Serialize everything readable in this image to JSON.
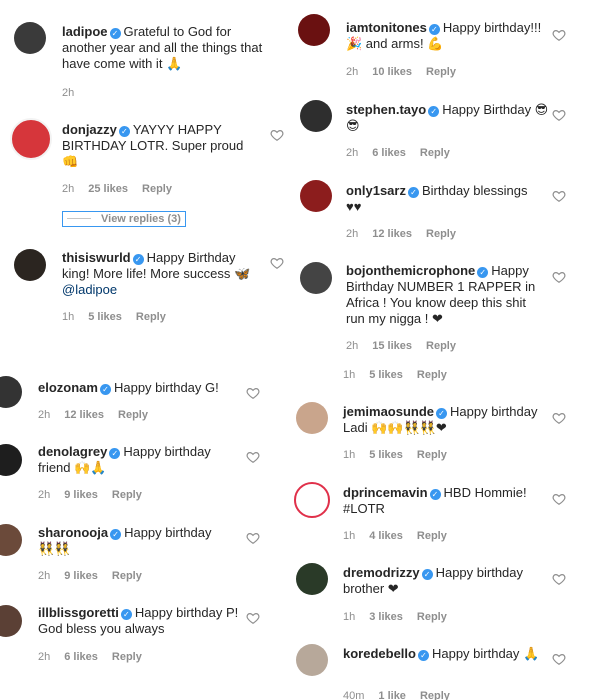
{
  "left_top": [
    {
      "user": "ladipoe",
      "text": "Grateful to God for another year and all the things that have come with it 🙏",
      "time": "2h",
      "likes": "",
      "reply": ""
    },
    {
      "user": "donjazzy",
      "text": "YAYYY HAPPY BIRTHDAY LOTR. Super proud 👊",
      "time": "2h",
      "likes": "25 likes",
      "reply": "Reply"
    },
    {
      "user": "thisiswurld",
      "text": "Happy Birthday king! More life! More success 🦋",
      "mention": "@ladipoe",
      "time": "1h",
      "likes": "5 likes",
      "reply": "Reply"
    }
  ],
  "view_replies": "View replies (3)",
  "left_bottom": [
    {
      "user": "elozonam",
      "text": "Happy birthday G!",
      "time": "2h",
      "likes": "12 likes",
      "reply": "Reply"
    },
    {
      "user": "denolagrey",
      "text": "Happy birthday friend 🙌🙏",
      "time": "2h",
      "likes": "9 likes",
      "reply": "Reply"
    },
    {
      "user": "sharonooja",
      "text": "Happy birthday 👯👯",
      "time": "2h",
      "likes": "9 likes",
      "reply": "Reply"
    },
    {
      "user": "illblissgoretti",
      "text": "Happy birthday P! God bless you always",
      "time": "2h",
      "likes": "6 likes",
      "reply": "Reply"
    }
  ],
  "right": [
    {
      "user": "iamtonitones",
      "text": "Happy birthday!!!🎉 and arms! 💪",
      "time": "2h",
      "likes": "10 likes",
      "reply": "Reply"
    },
    {
      "user": "stephen.tayo",
      "text": "Happy Birthday 😎😎",
      "time": "2h",
      "likes": "6 likes",
      "reply": "Reply"
    },
    {
      "user": "only1sarz",
      "text": "Birthday blessings ♥♥",
      "time": "2h",
      "likes": "12 likes",
      "reply": "Reply"
    },
    {
      "user": "bojonthemicrophone",
      "text": "Happy Birthday NUMBER 1 RAPPER in Africa ! You know deep this shit run my nigga ! ❤",
      "time": "2h",
      "likes": "15 likes",
      "reply": "Reply"
    },
    {
      "user": "",
      "text": "",
      "time": "1h",
      "likes": "5 likes",
      "reply": "Reply"
    },
    {
      "user": "jemimaosunde",
      "text": "Happy birthday Ladi 🙌🙌👯👯❤",
      "time": "1h",
      "likes": "5 likes",
      "reply": "Reply"
    },
    {
      "user": "dprincemavin",
      "text": "HBD Hommie! #LOTR",
      "time": "1h",
      "likes": "4 likes",
      "reply": "Reply"
    },
    {
      "user": "dremodrizzy",
      "text": "Happy birthday brother ❤",
      "time": "1h",
      "likes": "3 likes",
      "reply": "Reply"
    },
    {
      "user": "koredebello",
      "text": "Happy birthday 🙏",
      "time": "40m",
      "likes": "1 like",
      "reply": "Reply"
    }
  ],
  "colors": {
    "verified": "#3897f0",
    "meta": "#8e8e8e",
    "text": "#262626"
  }
}
